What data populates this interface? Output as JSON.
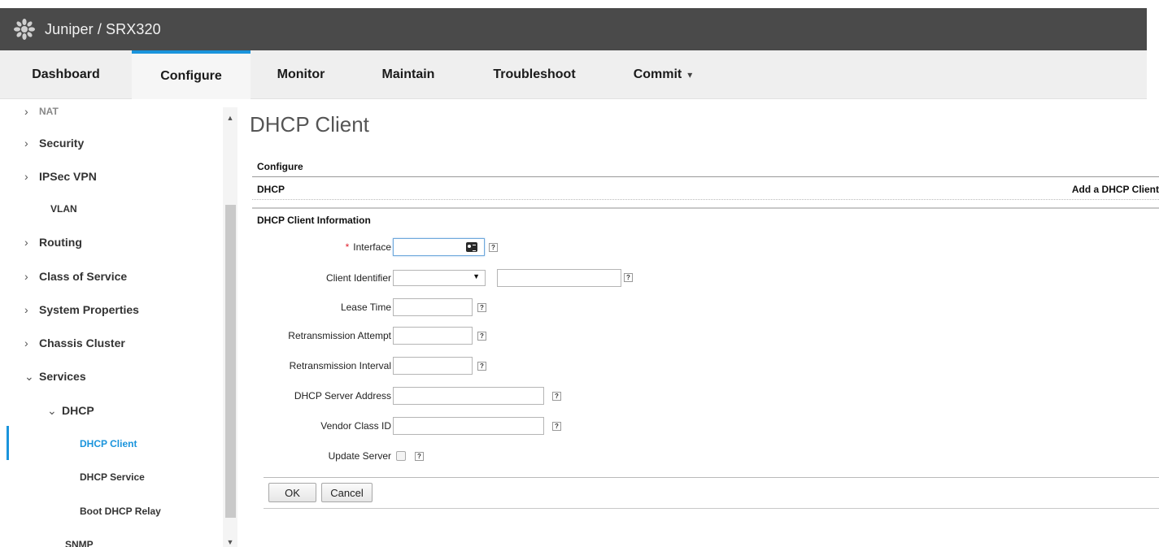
{
  "app": {
    "title": "Juniper / SRX320"
  },
  "nav": {
    "tabs": [
      {
        "label": "Dashboard"
      },
      {
        "label": "Configure"
      },
      {
        "label": "Monitor"
      },
      {
        "label": "Maintain"
      },
      {
        "label": "Troubleshoot"
      },
      {
        "label": "Commit",
        "caret": "▾"
      }
    ],
    "active": "Configure"
  },
  "sidebar": {
    "items": [
      {
        "label": "NAT",
        "chevron": "›"
      },
      {
        "label": "Security",
        "chevron": "›"
      },
      {
        "label": "IPSec VPN",
        "chevron": "›"
      },
      {
        "label": "VLAN",
        "chevron": ""
      },
      {
        "label": "Routing",
        "chevron": "›"
      },
      {
        "label": "Class of Service",
        "chevron": "›"
      },
      {
        "label": "System Properties",
        "chevron": "›"
      },
      {
        "label": "Chassis Cluster",
        "chevron": "›"
      },
      {
        "label": "Services",
        "chevron": "⌄"
      },
      {
        "label": "DHCP",
        "chevron": "⌄"
      },
      {
        "label": "DHCP Client",
        "chevron": ""
      },
      {
        "label": "DHCP Service",
        "chevron": ""
      },
      {
        "label": "Boot DHCP Relay",
        "chevron": ""
      },
      {
        "label": "SNMP",
        "chevron": ""
      }
    ],
    "selected": "DHCP Client",
    "scroll_up": "▲",
    "scroll_down": "▼"
  },
  "page": {
    "title": "DHCP Client",
    "section_configure": "Configure",
    "section_dhcp": "DHCP",
    "add_link": "Add a DHCP Client",
    "section_info": "DHCP Client Information"
  },
  "form": {
    "required_mark": "*",
    "help_glyph": "?",
    "interface": {
      "label": "Interface",
      "value": ""
    },
    "client_identifier": {
      "label": "Client Identifier",
      "selected": "",
      "value": ""
    },
    "lease_time": {
      "label": "Lease Time",
      "value": ""
    },
    "retransmission_attempt": {
      "label": "Retransmission Attempt",
      "value": ""
    },
    "retransmission_interval": {
      "label": "Retransmission Interval",
      "value": ""
    },
    "dhcp_server_address": {
      "label": "DHCP Server Address",
      "value": ""
    },
    "vendor_class_id": {
      "label": "Vendor Class ID",
      "value": ""
    },
    "update_server": {
      "label": "Update Server",
      "checked": false
    }
  },
  "buttons": {
    "ok": "OK",
    "cancel": "Cancel"
  },
  "colors": {
    "accent": "#1a94dc",
    "titlebar": "#4a4a4a",
    "required": "#e0202c"
  }
}
